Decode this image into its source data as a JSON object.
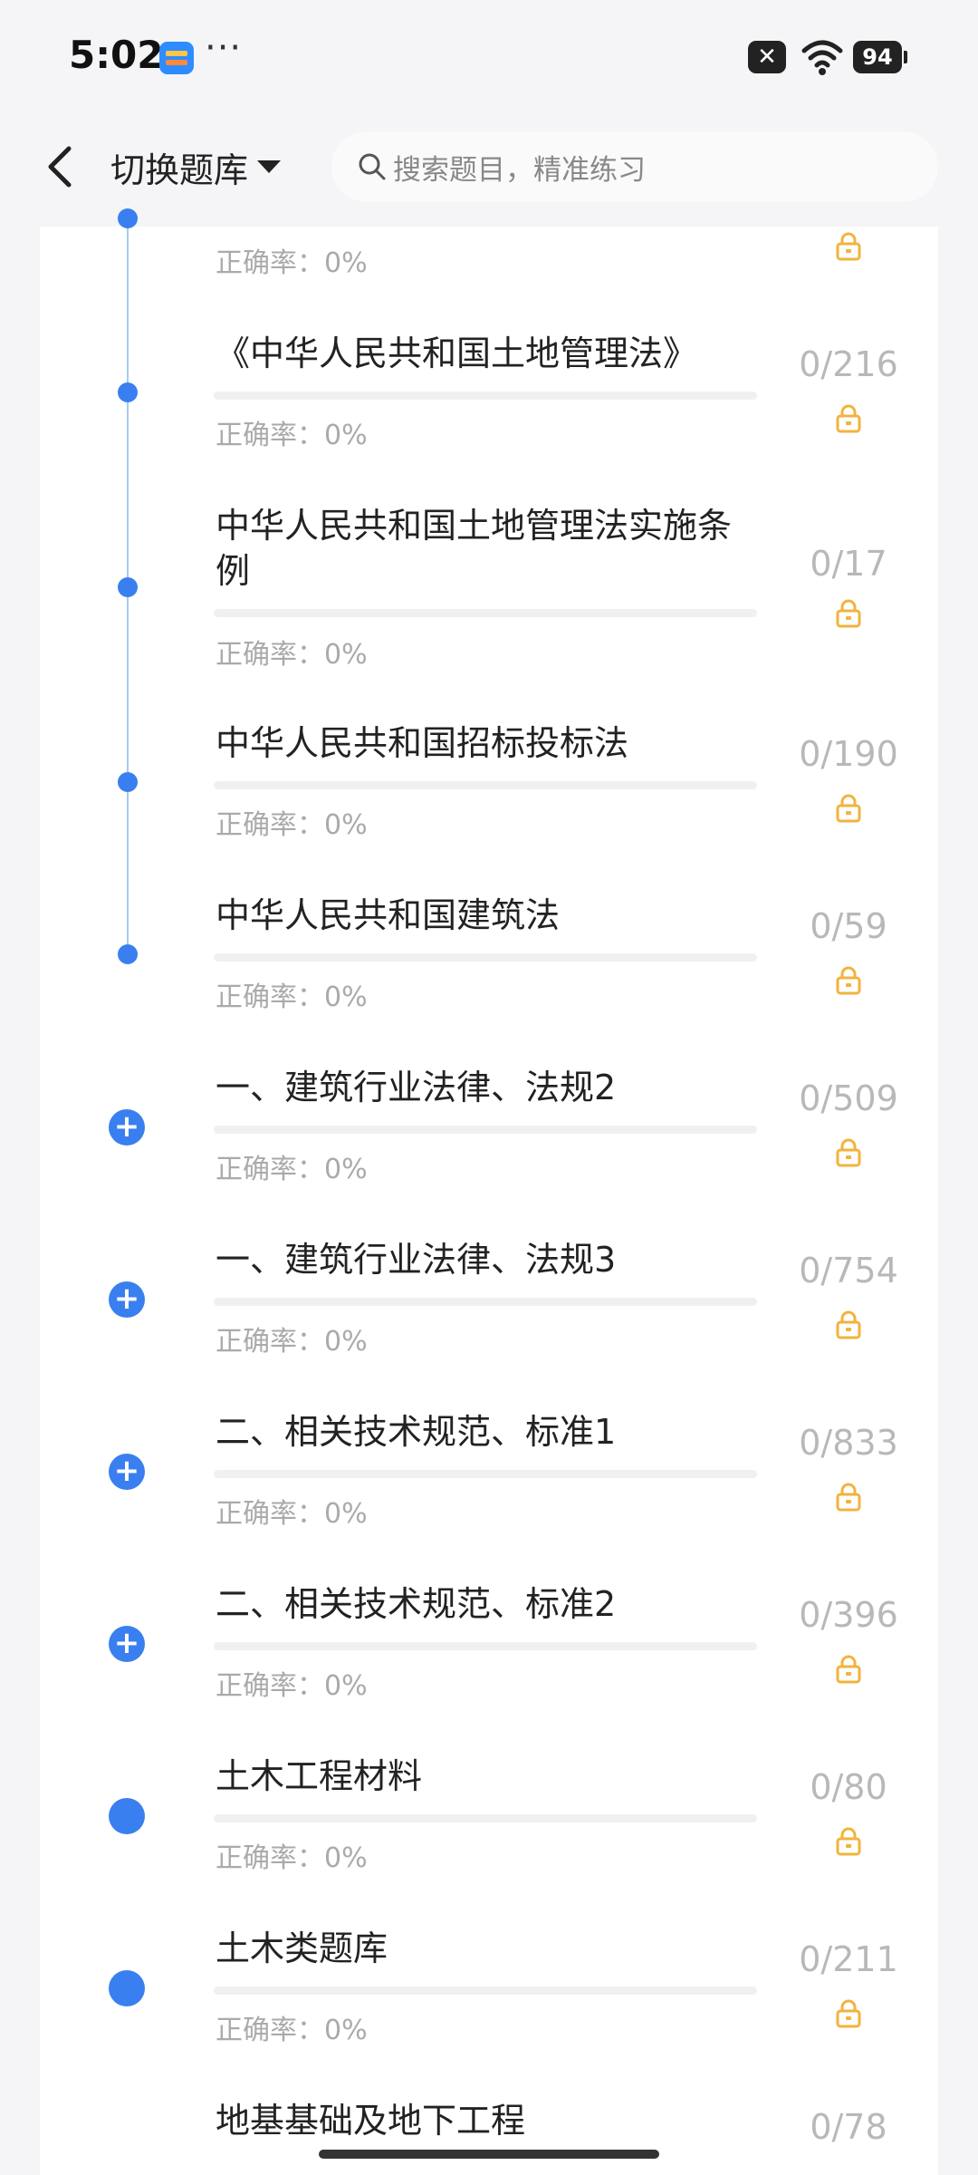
{
  "status_bar": {
    "time": "5:02",
    "more": "···",
    "x_badge": "✕",
    "battery": "94"
  },
  "header": {
    "switch_label": "切换题库",
    "search_placeholder": "搜索题目，精准练习"
  },
  "colors": {
    "accent": "#3a7ff0",
    "lock": "#f2b33d",
    "muted": "#aaaaaa"
  },
  "list": [
    {
      "title": "",
      "rate": "正确率：0%",
      "count": "",
      "marker": "small"
    },
    {
      "title": "《中华人民共和国土地管理法》",
      "rate": "正确率：0%",
      "count": "0/216",
      "marker": "small"
    },
    {
      "title": "中华人民共和国土地管理法实施条例",
      "rate": "正确率：0%",
      "count": "0/17",
      "marker": "small"
    },
    {
      "title": "中华人民共和国招标投标法",
      "rate": "正确率：0%",
      "count": "0/190",
      "marker": "small"
    },
    {
      "title": "中华人民共和国建筑法",
      "rate": "正确率：0%",
      "count": "0/59",
      "marker": "small"
    },
    {
      "title": "一、建筑行业法律、法规2",
      "rate": "正确率：0%",
      "count": "0/509",
      "marker": "plus"
    },
    {
      "title": "一、建筑行业法律、法规3",
      "rate": "正确率：0%",
      "count": "0/754",
      "marker": "plus"
    },
    {
      "title": "二、相关技术规范、标准1",
      "rate": "正确率：0%",
      "count": "0/833",
      "marker": "plus"
    },
    {
      "title": "二、相关技术规范、标准2",
      "rate": "正确率：0%",
      "count": "0/396",
      "marker": "plus"
    },
    {
      "title": "土木工程材料",
      "rate": "正确率：0%",
      "count": "0/80",
      "marker": "big"
    },
    {
      "title": "土木类题库",
      "rate": "正确率：0%",
      "count": "0/211",
      "marker": "big"
    },
    {
      "title": "地基基础及地下工程",
      "rate": "",
      "count": "0/78",
      "marker": "none"
    }
  ]
}
